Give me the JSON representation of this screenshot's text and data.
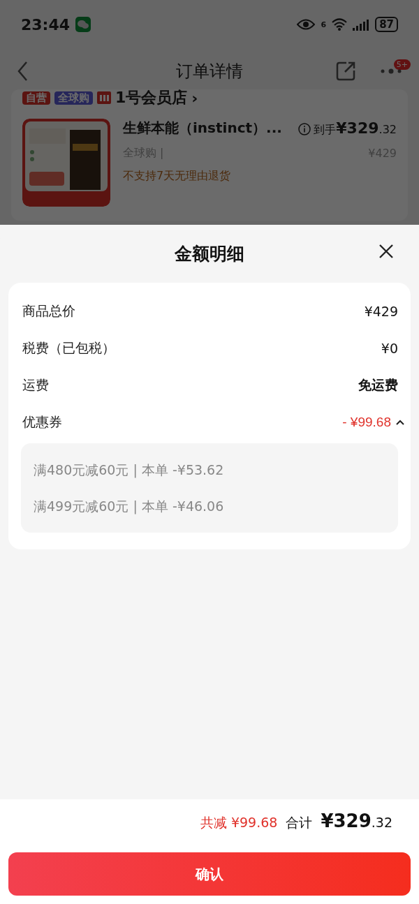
{
  "status_bar": {
    "time": "23:44",
    "battery": "87",
    "wifi_badge": "6"
  },
  "nav": {
    "title": "订单详情",
    "badge": "5+"
  },
  "shop": {
    "tags": [
      {
        "label": "自营",
        "kind": "self"
      },
      {
        "label": "全球购",
        "kind": "global"
      }
    ],
    "name": "1号会员店",
    "chevron": "›"
  },
  "product": {
    "kind": "picture",
    "name": "生鲜本能（instinct）...",
    "price_label": "到手",
    "price_int": "¥329",
    "price_dec": ".32",
    "spec": "全球购 |",
    "original_price": "¥429",
    "notice": "不支持7天无理由退货"
  },
  "sheet": {
    "title": "金额明细",
    "rows": [
      {
        "kind": "plain",
        "label": "商品总价",
        "value": "¥429"
      },
      {
        "kind": "plain",
        "label": "税费（已包税）",
        "value": "¥0"
      },
      {
        "kind": "bold",
        "label": "运费",
        "value": "免运费"
      },
      {
        "kind": "discount",
        "label": "优惠券",
        "value": "- ¥99.68",
        "expanded": true,
        "details": [
          "满480元减60元 | 本单 -¥53.62",
          "满499元减60元 | 本单 -¥46.06"
        ]
      }
    ]
  },
  "footer": {
    "saved": "共减 ¥99.68",
    "total_label": "合计",
    "total_int": "¥329",
    "total_dec": ".32",
    "confirm": "确认"
  }
}
